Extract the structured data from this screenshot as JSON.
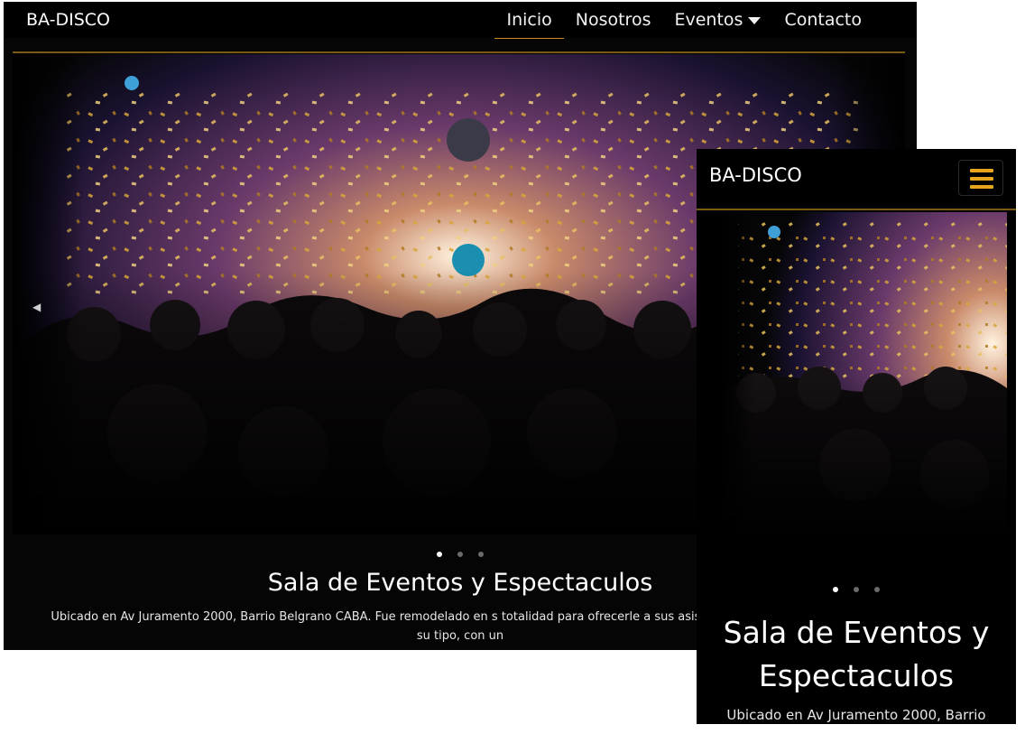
{
  "desktop": {
    "brand": "BA-DISCO",
    "nav": [
      {
        "label": "Inicio"
      },
      {
        "label": "Nosotros"
      },
      {
        "label": "Eventos"
      },
      {
        "label": "Contacto"
      }
    ],
    "carousel": {
      "active_slide": 1,
      "slide_count": 3,
      "title": "Sala de Eventos y Espectaculos",
      "text": "Ubicado en Av Juramento 2000, Barrio Belgrano CABA. Fue remodelado en s totalidad para ofrecerle a sus asistentes una locación única en su tipo, con un"
    }
  },
  "mobile": {
    "brand": "BA-DISCO",
    "carousel": {
      "active_slide": 1,
      "slide_count": 3,
      "title": "Sala de Eventos y Espectaculos",
      "text": "Ubicado en Av Juramento 2000, Barrio"
    }
  },
  "colors": {
    "accent": "#e7a51e",
    "divider": "#7a5a12",
    "nav_bg": "#000000"
  }
}
